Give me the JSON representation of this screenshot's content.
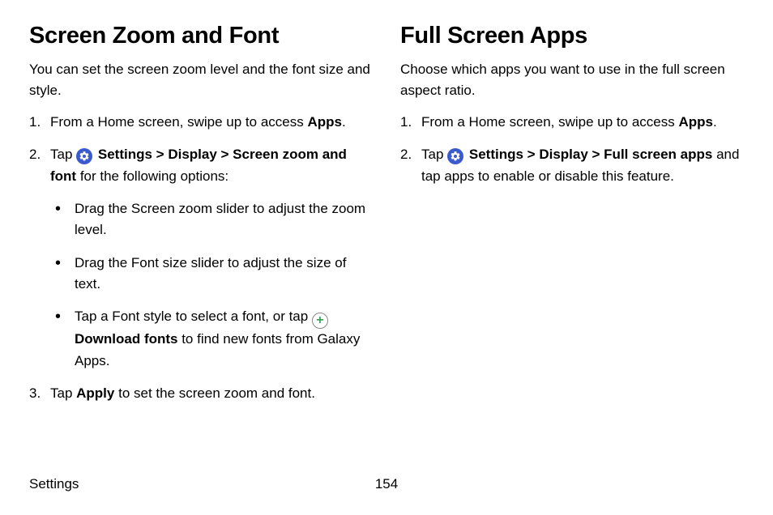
{
  "left": {
    "heading": "Screen Zoom and Font",
    "intro": "You can set the screen zoom level and the font size and style.",
    "step1_pre": "From a Home screen, swipe up to access ",
    "step1_bold": "Apps",
    "step1_post": ".",
    "step2_pre": "Tap ",
    "step2_settings": "Settings",
    "step2_arrow1": " > ",
    "step2_display": "Display",
    "step2_arrow2": " > ",
    "step2_screenzoom": "Screen zoom and font",
    "step2_post": " for the following options:",
    "bullet1": "Drag the Screen zoom slider to adjust the zoom level.",
    "bullet2": "Drag the Font size slider to adjust the size of text.",
    "bullet3_pre": "Tap a Font style to select a font, or tap ",
    "bullet3_bold": "Download fonts",
    "bullet3_post": " to find new fonts from Galaxy Apps.",
    "step3_pre": "Tap ",
    "step3_bold": "Apply",
    "step3_post": " to set the screen zoom and font."
  },
  "right": {
    "heading": "Full Screen Apps",
    "intro": "Choose which apps you want to use in the full screen aspect ratio.",
    "step1_pre": "From a Home screen, swipe up to access ",
    "step1_bold": "Apps",
    "step1_post": ".",
    "step2_pre": "Tap ",
    "step2_settings": "Settings",
    "step2_arrow1": " > ",
    "step2_display": "Display",
    "step2_arrow2": " > ",
    "step2_fullscreen": "Full screen apps",
    "step2_post": " and tap apps to enable or disable this feature."
  },
  "footer": {
    "section": "Settings",
    "page": "154"
  }
}
